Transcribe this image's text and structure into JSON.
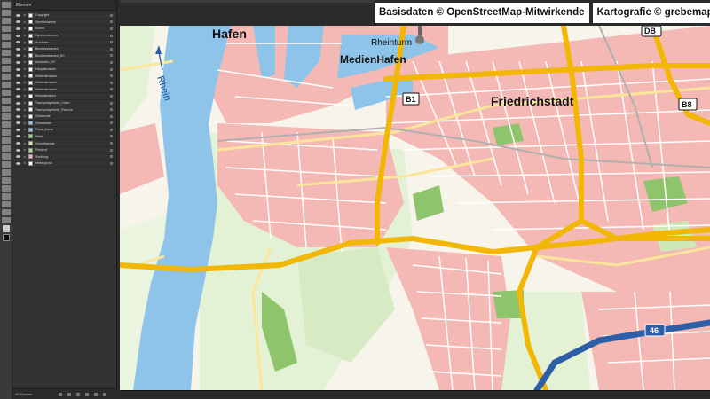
{
  "attribution": {
    "data_source": "Basisdaten © OpenStreetMap-Mitwirkende",
    "cartography": "Kartografie © grebemaps.de"
  },
  "layers_panel": {
    "title": "Ebenen",
    "footer_count": "20 Ebenen",
    "items": [
      {
        "label": "Copyright",
        "color": "#ffffff"
      },
      {
        "label": "Symbolnamen",
        "color": "#ffffff"
      },
      {
        "label": "Schrift",
        "color": "#ffffff"
      },
      {
        "label": "Symbolnummer",
        "color": "#ffffff"
      },
      {
        "label": "Autobahn",
        "color": "#ffffff"
      },
      {
        "label": "Bundesstrassen",
        "color": "#ffffff"
      },
      {
        "label": "Bundesstrassen_HC",
        "color": "#ffffff"
      },
      {
        "label": "Autobahn_HC",
        "color": "#ffffff"
      },
      {
        "label": "Hauptstrassen",
        "color": "#ffffff"
      },
      {
        "label": "Nebenstrassen",
        "color": "#ffffff"
      },
      {
        "label": "Nebenstrassen",
        "color": "#ffffff"
      },
      {
        "label": "Nebenstrassen",
        "color": "#ffffff"
      },
      {
        "label": "Wohnstrassen",
        "color": "#ffffff"
      },
      {
        "label": "Transportgebiete_Linien",
        "color": "#ffffff"
      },
      {
        "label": "Transportgebiete_Flaeche",
        "color": "#ffffff"
      },
      {
        "label": "Gebaeude",
        "color": "#ffffff"
      },
      {
        "label": "Gewaesser",
        "color": "#8fc4ea"
      },
      {
        "label": "Fluss_Kanal",
        "color": "#8fc4ea"
      },
      {
        "label": "Wald",
        "color": "#9fd07f"
      },
      {
        "label": "Gruenflaeche",
        "color": "#cfe8b8"
      },
      {
        "label": "Friedhof",
        "color": "#b7d7a0"
      },
      {
        "label": "Siedlung",
        "color": "#f4b9b5"
      },
      {
        "label": "Hintergrund",
        "color": "#ffffff"
      }
    ]
  },
  "map": {
    "labels": {
      "hafen": "Hafen",
      "medienhafen": "MedienHafen",
      "rheinturm": "Rheinturm",
      "friedrichstadt": "Friedrichstadt",
      "river": "Rhein"
    },
    "shields": {
      "b1": "B1",
      "b8": "B8",
      "db": "DB",
      "a46": "46"
    },
    "colors": {
      "water": "#8fc4ea",
      "settlement": "#f4b9b5",
      "green": "#d6ebc3",
      "forest": "#8ec46b",
      "highway_yellow": "#f2b705",
      "motorway_blue": "#2f5ea8",
      "background": "#f7f4ec"
    }
  }
}
